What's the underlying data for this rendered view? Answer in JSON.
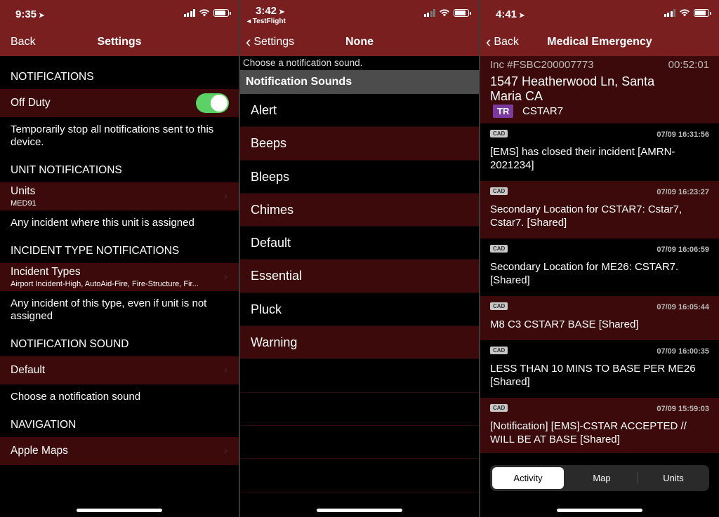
{
  "settings": {
    "time": "9:35",
    "back_label": "Back",
    "title": "Settings",
    "sections": {
      "notifications": "NOTIFICATIONS",
      "unit": "UNIT NOTIFICATIONS",
      "incident_type": "INCIDENT TYPE NOTIFICATIONS",
      "sound": "NOTIFICATION SOUND",
      "navigation": "NAVIGATION"
    },
    "off_duty": {
      "label": "Off Duty",
      "on": true,
      "note": "Temporarily stop all notifications sent to this device."
    },
    "units": {
      "label": "Units",
      "value": "MED91",
      "note": "Any incident where this unit is assigned"
    },
    "incident_types": {
      "label": "Incident Types",
      "value": "Airport Incident-High, AutoAid-Fire, Fire-Structure, Fir...",
      "note": "Any incident of this type, even if unit is not assigned"
    },
    "sound": {
      "value": "Default",
      "note": "Choose a notification sound"
    },
    "navigation": {
      "value": "Apple Maps"
    }
  },
  "sounds_screen": {
    "time": "3:42",
    "sub_status": "◂ TestFlight",
    "back_label": "Settings",
    "title": "None",
    "hint": "Choose a notification sound.",
    "group_title": "Notification Sounds",
    "sounds": [
      "Alert",
      "Beeps",
      "Bleeps",
      "Chimes",
      "Default",
      "Essential",
      "Pluck",
      "Warning"
    ]
  },
  "incident_screen": {
    "time": "4:41",
    "back_label": "Back",
    "title": "Medical Emergency",
    "incident_no": "Inc #FSBC200007773",
    "timer": "00:52:01",
    "address": "1547 Heatherwood Ln, Santa Maria CA",
    "badge": "TR",
    "unit": "CSTAR7",
    "entries": [
      {
        "tag": "CAD",
        "ts": "07/09 16:31:56",
        "text": "[EMS] has closed their incident [AMRN-2021234]"
      },
      {
        "tag": "CAD",
        "ts": "07/09 16:23:27",
        "text": "Secondary Location for CSTAR7: Cstar7, Cstar7. [Shared]"
      },
      {
        "tag": "CAD",
        "ts": "07/09 16:06:59",
        "text": "Secondary Location for ME26: CSTAR7. [Shared]"
      },
      {
        "tag": "CAD",
        "ts": "07/09 16:05:44",
        "text": "M8 C3 CSTAR7 BASE [Shared]"
      },
      {
        "tag": "CAD",
        "ts": "07/09 16:00:35",
        "text": "LESS THAN 10 MINS TO BASE PER ME26 [Shared]"
      },
      {
        "tag": "CAD",
        "ts": "07/09 15:59:03",
        "text": "[Notification] [EMS]-CSTAR ACCEPTED // WILL BE AT BASE [Shared]"
      }
    ],
    "tabs": [
      "Activity",
      "Map",
      "Units"
    ],
    "active_tab": "Activity"
  },
  "colors": {
    "nav_bar": "#7a1f1f",
    "row_dark_red": "#3c0a0a",
    "toggle_on": "#5cd166",
    "badge_tr": "#7c3aa0"
  }
}
